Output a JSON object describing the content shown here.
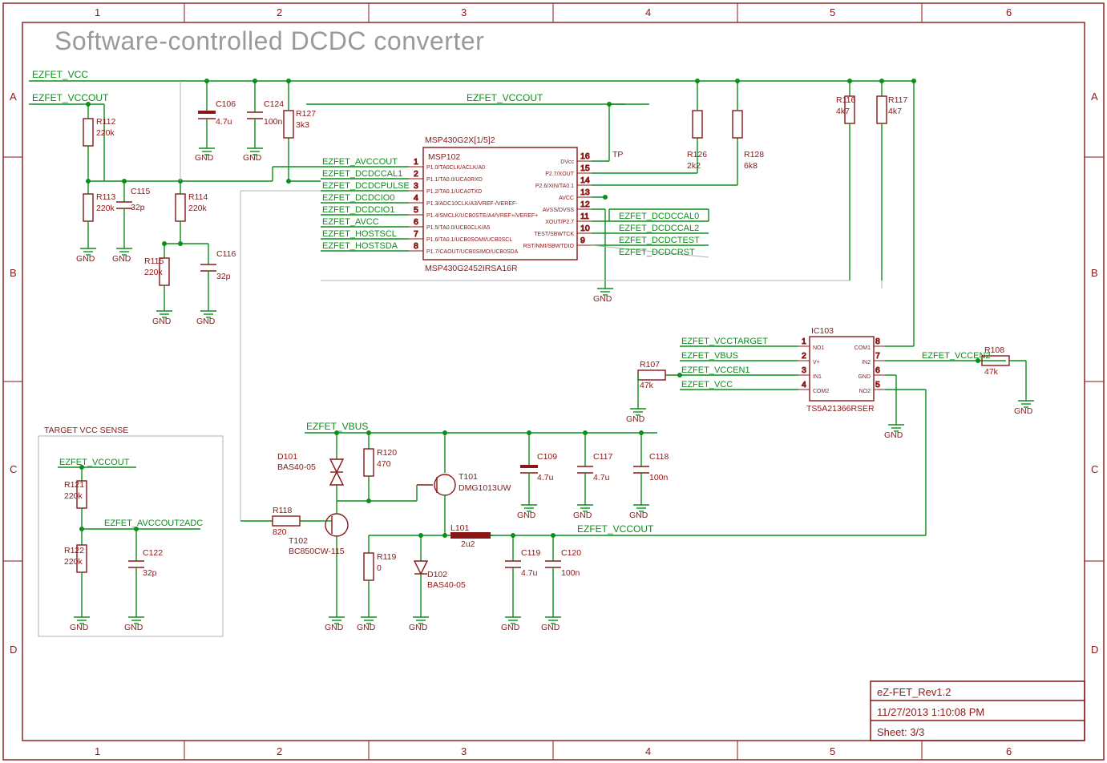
{
  "page_title": "Software-controlled DCDC converter",
  "frame": {
    "cols": [
      "1",
      "2",
      "3",
      "4",
      "5",
      "6"
    ],
    "rows": [
      "A",
      "B",
      "C",
      "D"
    ]
  },
  "title_block": {
    "line1": "eZ-FET_Rev1.2",
    "line2": "11/27/2013 1:10:08 PM",
    "line3": "Sheet: 3/3"
  },
  "nets": {
    "ezfet_vcc_top": "EZFET_VCC",
    "ezfet_vccout_top": "EZFET_VCCOUT",
    "ezfet_vccout_mid": "EZFET_VCCOUT",
    "ezfet_vccout_sense": "EZFET_VCCOUT",
    "ezfet_vccout_bot": "EZFET_VCCOUT",
    "ezfet_vbus": "EZFET_VBUS",
    "ezfet_vbus2": "EZFET_VBUS",
    "ezfet_avccout": "EZFET_AVCCOUT",
    "ezfet_avccout2adc": "EZFET_AVCCOUT2ADC",
    "ezfet_dcdccal1": "EZFET_DCDCCAL1",
    "ezfet_dcdcpulse": "EZFET_DCDCPULSE",
    "ezfet_dcdcio0": "EZFET_DCDCIO0",
    "ezfet_dcdcio1": "EZFET_DCDCIO1",
    "ezfet_avcc": "EZFET_AVCC",
    "ezfet_hostscl": "EZFET_HOSTSCL",
    "ezfet_hostsda": "EZFET_HOSTSDA",
    "ezfet_dcdccal0": "EZFET_DCDCCAL0",
    "ezfet_dcdccal2": "EZFET_DCDCCAL2",
    "ezfet_dcdctest": "EZFET_DCDCTEST",
    "ezfet_dcdcrst": "EZFET_DCDCRST",
    "ezfet_vcctarget": "EZFET_VCCTARGET",
    "ezfet_vccen1": "EZFET_VCCEN1",
    "ezfet_vcc_sw": "EZFET_VCC",
    "ezfet_vccen2": "EZFET_VCCEN2",
    "tp": "TP"
  },
  "gnd": "GND",
  "sense_box_title": "TARGET VCC SENSE",
  "components": {
    "MSP102_header": "MSP430G2X[1/5]2",
    "MSP102_ref": "MSP102",
    "MSP102_part": "MSP430G2452IRSA16R",
    "MSP102_pins_left": {
      "1": "P1.0/TA0CLK/ACLK/A0",
      "2": "P1.1/TA0.0/UCA0RXD",
      "3": "P1.2/TA0.1/UCA0TXD",
      "4": "P1.3/ADC10CLK/A3/VREF-/VEREF-",
      "5": "P1.4/SMCLK/UCB0STE/A4/VREF+/VEREF+",
      "6": "P1.5/TA0.0/UCB0CLK/A5",
      "7": "P1.6/TA0.1/UCB0SOMI/UCB0SCL",
      "8": "P1.7/CAOUT/UCB0SIMO/UCB0SDA"
    },
    "MSP102_pins_right": {
      "16": "DVcc",
      "15": "P2.7/XOUT",
      "14": "P2.6/XIN/TA0.1",
      "13": "AVCC",
      "12": "AVSS/DVSS",
      "11": "XOUT/P2.7",
      "10": "TEST/SBWTCK",
      "9": "RST/NMI/SBWTDIO"
    },
    "IC103_ref": "IC103",
    "IC103_part": "TS5A21366RSER",
    "IC103_pins": {
      "1": "NO1",
      "8": "COM1",
      "2": "V+",
      "7": "IN2",
      "3": "IN1",
      "6": "GND",
      "4": "COM2",
      "5": "NO2"
    },
    "R112": {
      "ref": "R112",
      "val": "220k"
    },
    "R113": {
      "ref": "R113",
      "val": "220k"
    },
    "R114": {
      "ref": "R114",
      "val": "220k"
    },
    "R115": {
      "ref": "R115",
      "val": "220k"
    },
    "R116": {
      "ref": "R116",
      "val": "4k7"
    },
    "R117": {
      "ref": "R117",
      "val": "4k7"
    },
    "R118": {
      "ref": "R118",
      "val": "820"
    },
    "R119": {
      "ref": "R119",
      "val": "0"
    },
    "R120": {
      "ref": "R120",
      "val": "470"
    },
    "R121": {
      "ref": "R121",
      "val": "220k"
    },
    "R122": {
      "ref": "R122",
      "val": "220k"
    },
    "R126": {
      "ref": "R126",
      "val": "2k2"
    },
    "R127": {
      "ref": "R127",
      "val": "3k3"
    },
    "R128": {
      "ref": "R128",
      "val": "6k8"
    },
    "R107": {
      "ref": "R107",
      "val": "47k"
    },
    "R108": {
      "ref": "R108",
      "val": "47k"
    },
    "C106": {
      "ref": "C106",
      "val": "4.7u"
    },
    "C109": {
      "ref": "C109",
      "val": "4.7u"
    },
    "C115": {
      "ref": "C115",
      "val": "32p"
    },
    "C116": {
      "ref": "C116",
      "val": "32p"
    },
    "C117": {
      "ref": "C117",
      "val": "4.7u"
    },
    "C118": {
      "ref": "C118",
      "val": "100n"
    },
    "C119": {
      "ref": "C119",
      "val": "4.7u"
    },
    "C120": {
      "ref": "C120",
      "val": "100n"
    },
    "C122": {
      "ref": "C122",
      "val": "32p"
    },
    "C124": {
      "ref": "C124",
      "val": "100n"
    },
    "D101": {
      "ref": "D101",
      "val": "BAS40-05"
    },
    "D102": {
      "ref": "D102",
      "val": "BAS40-05"
    },
    "T101": {
      "ref": "T101",
      "val": "DMG1013UW"
    },
    "T102": {
      "ref": "T102",
      "val": "BC850CW-115"
    },
    "L101": {
      "ref": "L101",
      "val": "2u2"
    }
  }
}
